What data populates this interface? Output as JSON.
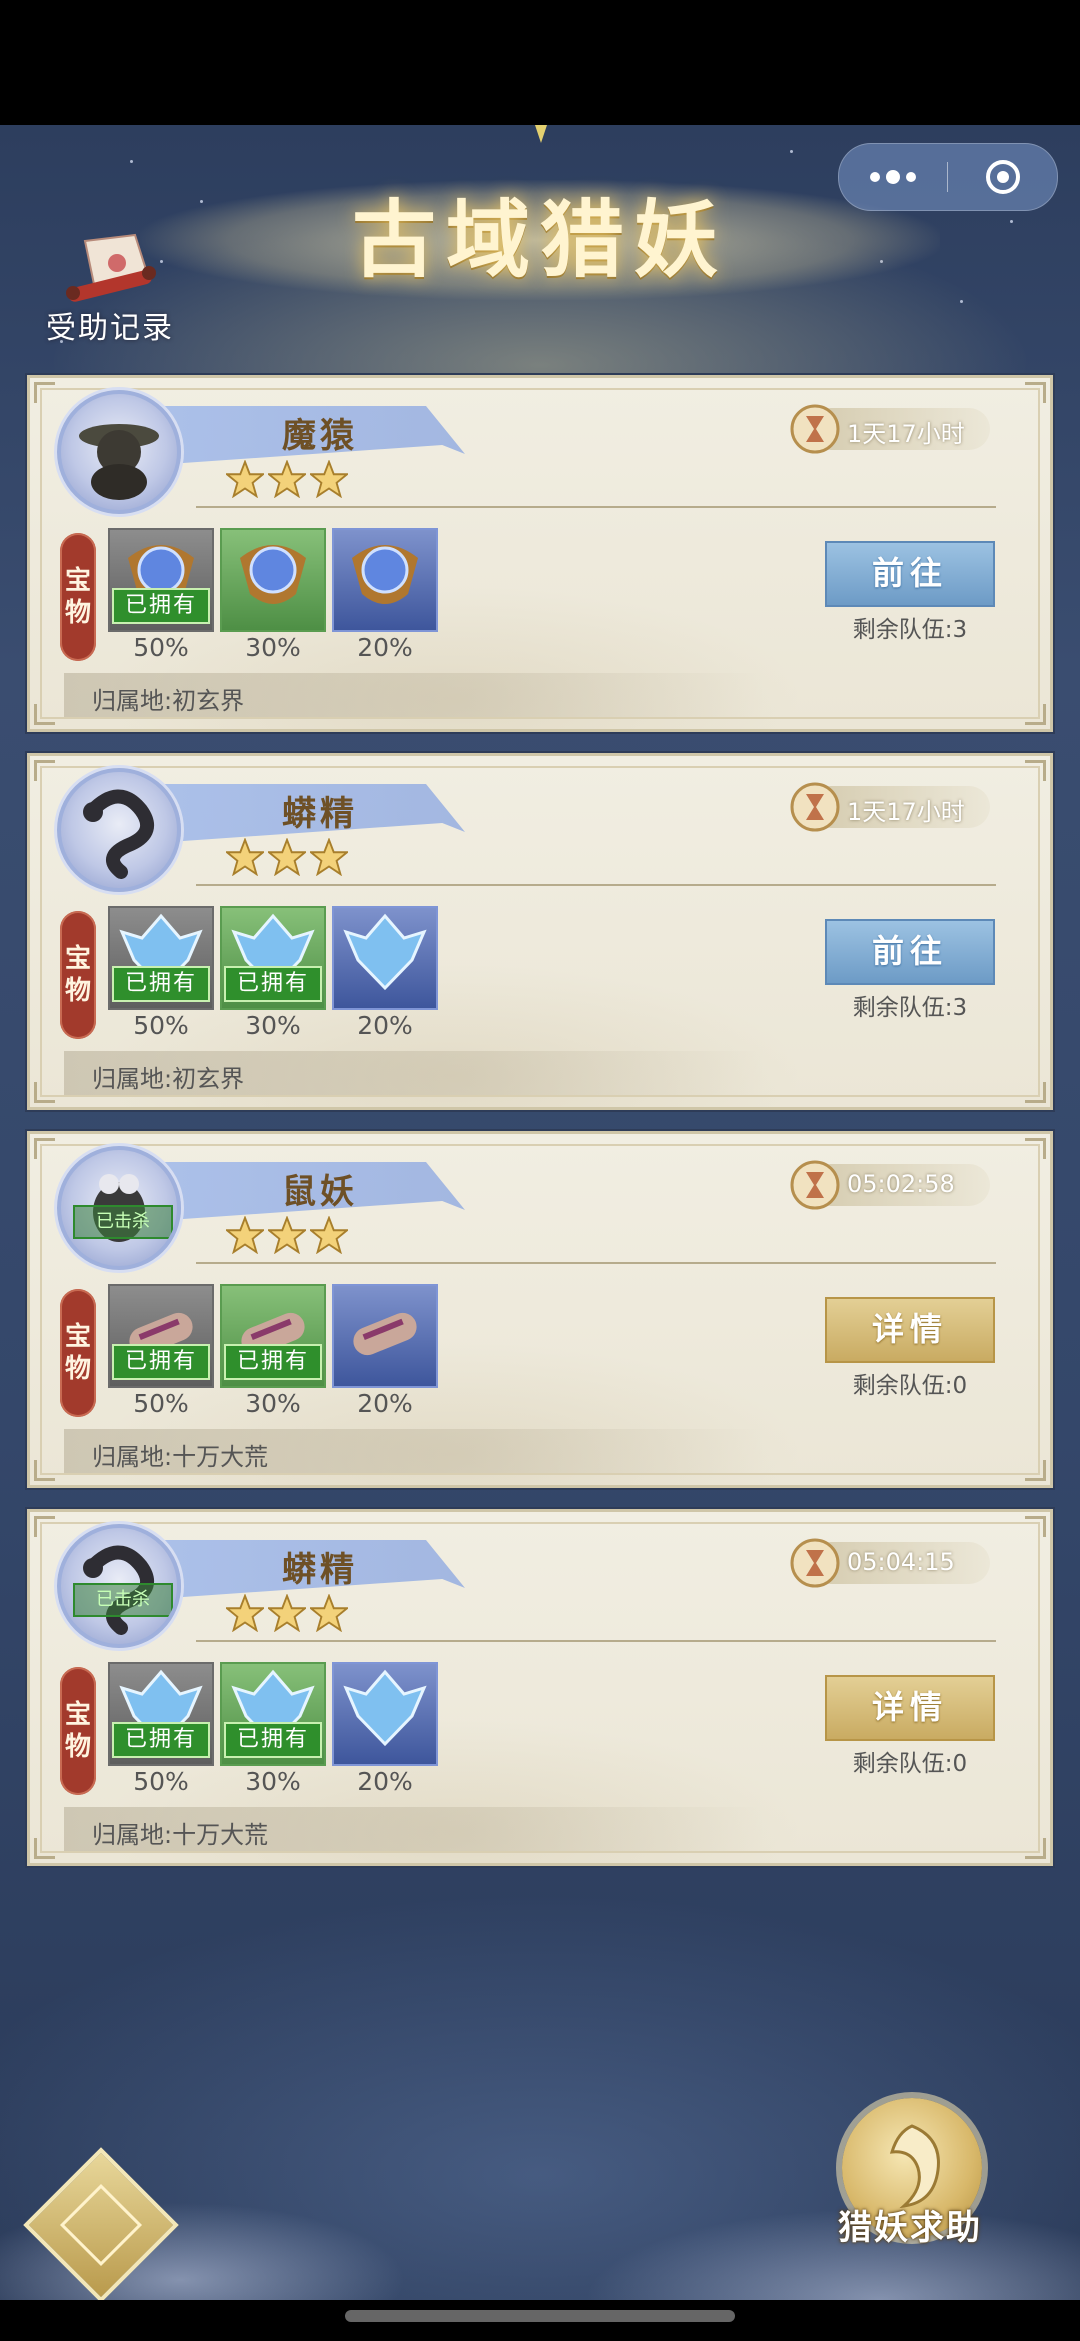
{
  "title": "古域猎妖",
  "help_record_label": "受助记录",
  "hunt_help_label": "猎妖求助",
  "owned_label": "已拥有",
  "treasure_label": [
    "宝",
    "物"
  ],
  "killed_label": "已击杀",
  "hunts": [
    {
      "name": "魔猿",
      "stars": 3,
      "timer": "1天17小时",
      "killed": false,
      "items": [
        {
          "type": "orb",
          "pct": "50%",
          "owned": true,
          "rarity": "gray"
        },
        {
          "type": "orb",
          "pct": "30%",
          "owned": false,
          "rarity": "green"
        },
        {
          "type": "orb",
          "pct": "20%",
          "owned": false,
          "rarity": "blue"
        }
      ],
      "action": "前往",
      "action_style": "blue",
      "remaining": "剩余队伍:3",
      "territory": "归属地:初玄界"
    },
    {
      "name": "蟒精",
      "stars": 3,
      "timer": "1天17小时",
      "killed": false,
      "items": [
        {
          "type": "crystal",
          "pct": "50%",
          "owned": true,
          "rarity": "gray"
        },
        {
          "type": "crystal",
          "pct": "30%",
          "owned": true,
          "rarity": "green"
        },
        {
          "type": "crystal",
          "pct": "20%",
          "owned": false,
          "rarity": "blue"
        }
      ],
      "action": "前往",
      "action_style": "blue",
      "remaining": "剩余队伍:3",
      "territory": "归属地:初玄界"
    },
    {
      "name": "鼠妖",
      "stars": 3,
      "timer": "05:02:58",
      "killed": true,
      "items": [
        {
          "type": "scroll",
          "pct": "50%",
          "owned": true,
          "rarity": "gray"
        },
        {
          "type": "scroll",
          "pct": "30%",
          "owned": true,
          "rarity": "green"
        },
        {
          "type": "scroll",
          "pct": "20%",
          "owned": false,
          "rarity": "blue"
        }
      ],
      "action": "详情",
      "action_style": "gold",
      "remaining": "剩余队伍:0",
      "territory": "归属地:十万大荒"
    },
    {
      "name": "蟒精",
      "stars": 3,
      "timer": "05:04:15",
      "killed": true,
      "items": [
        {
          "type": "crystal",
          "pct": "50%",
          "owned": true,
          "rarity": "gray"
        },
        {
          "type": "crystal",
          "pct": "30%",
          "owned": true,
          "rarity": "green"
        },
        {
          "type": "crystal",
          "pct": "20%",
          "owned": false,
          "rarity": "blue"
        }
      ],
      "action": "详情",
      "action_style": "gold",
      "remaining": "剩余队伍:0",
      "territory": "归属地:十万大荒"
    }
  ]
}
